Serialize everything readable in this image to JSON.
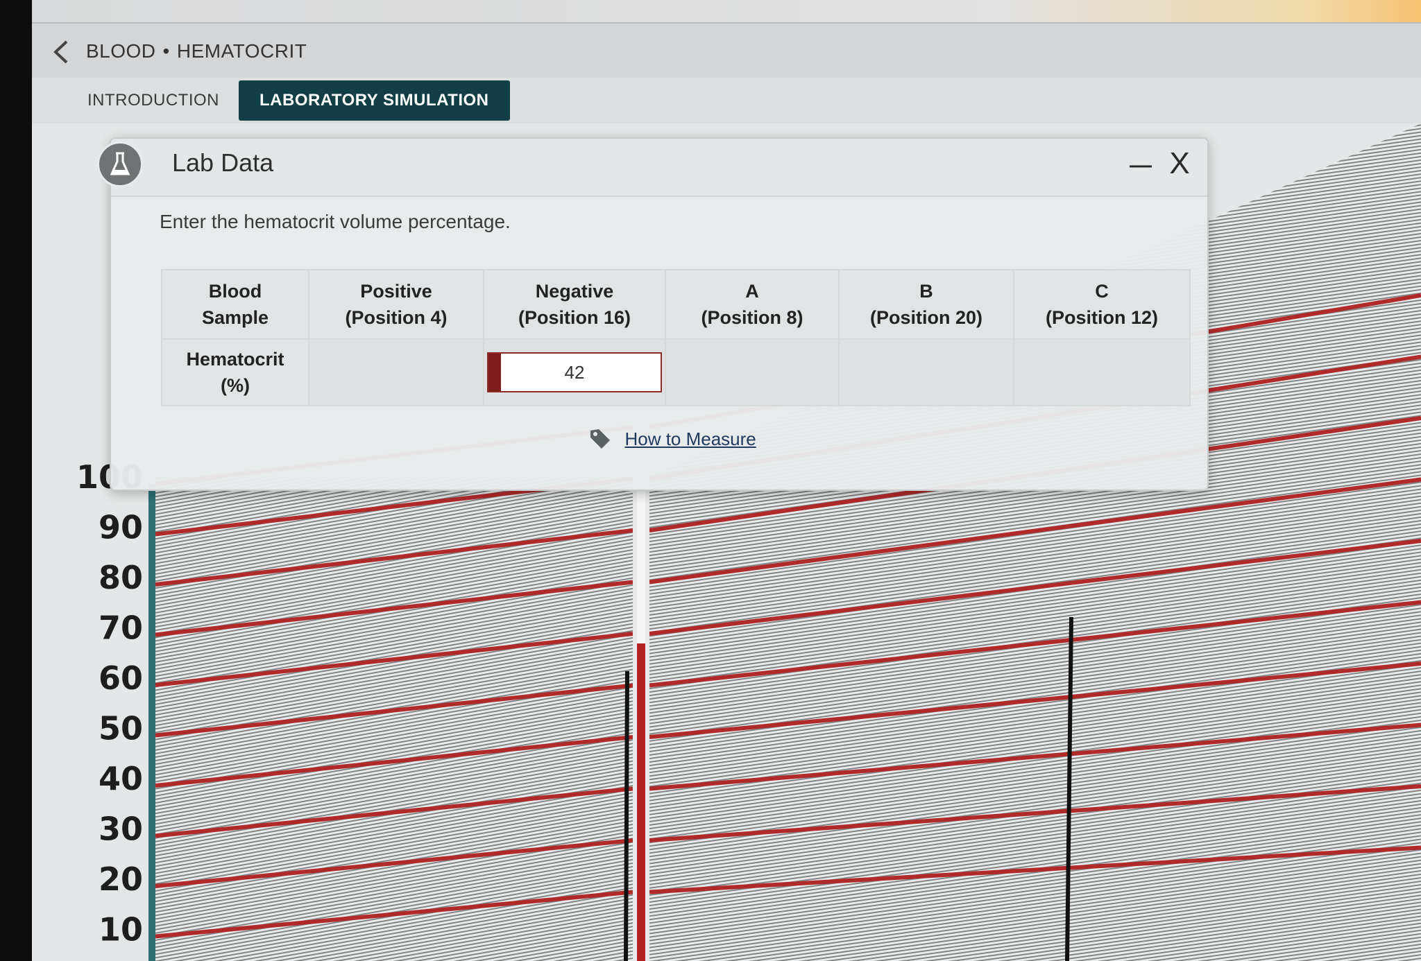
{
  "header": {
    "breadcrumb_section": "BLOOD",
    "breadcrumb_separator": "•",
    "breadcrumb_page": "HEMATOCRIT"
  },
  "tabs": [
    {
      "label": "INTRODUCTION",
      "active": false
    },
    {
      "label": "LABORATORY SIMULATION",
      "active": true
    }
  ],
  "lab_panel": {
    "title": "Lab Data",
    "minimize_label": "—",
    "close_label": "X",
    "instruction": "Enter the hematocrit volume percentage.",
    "table": {
      "headers": [
        {
          "line1": "Blood",
          "line2": "Sample"
        },
        {
          "line1": "Positive",
          "line2": "(Position 4)"
        },
        {
          "line1": "Negative",
          "line2": "(Position 16)"
        },
        {
          "line1": "A",
          "line2": "(Position 8)"
        },
        {
          "line1": "B",
          "line2": "(Position 20)"
        },
        {
          "line1": "C",
          "line2": "(Position 12)"
        }
      ],
      "row_label": {
        "line1": "Hematocrit",
        "line2": "(%)"
      },
      "values": {
        "positive": "",
        "negative": "42",
        "a": "",
        "b": "",
        "c": ""
      }
    },
    "how_to_link": "How to Measure"
  },
  "scale": {
    "labels": [
      "100",
      "90",
      "80",
      "70",
      "60",
      "50",
      "40",
      "30",
      "20",
      "10"
    ]
  },
  "colors": {
    "tab_active_bg": "#123f46",
    "red_line": "#b02a2a",
    "grid_line": "#2a2a2a",
    "input_marker": "#7f1d1d"
  },
  "icons": {
    "back": "chevron-left-icon",
    "flask": "flask-icon",
    "tag": "tag-icon"
  }
}
